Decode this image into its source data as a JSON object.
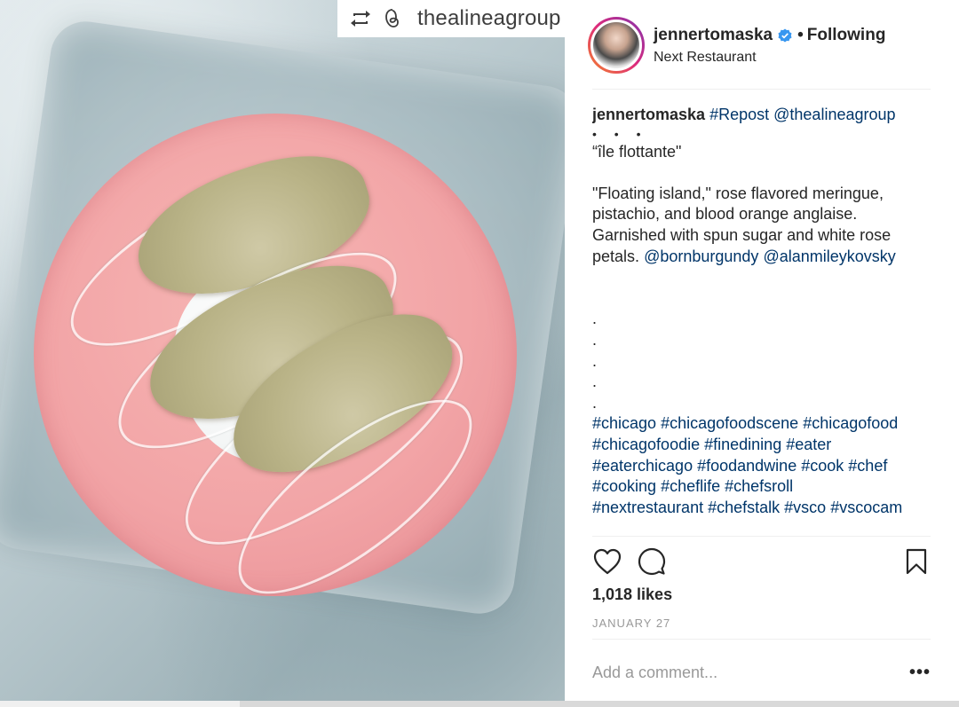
{
  "repost_tag": {
    "icons": [
      "repost-icon",
      "threads-icon"
    ],
    "username": "thealineagroup"
  },
  "header": {
    "username": "jennertomaska",
    "verified": true,
    "separator": "•",
    "follow_status": "Following",
    "location": "Next Restaurant"
  },
  "caption": {
    "author": "jennertomaska",
    "repost_tag": "#Repost",
    "repost_mention": "@thealineagroup",
    "dots_row": "• • •",
    "title": "“île flottante\"",
    "body_lines": [
      "\"Floating island,\" rose flavored meringue,",
      "pistachio, and blood orange anglaise.",
      "Garnished with spun sugar and white rose"
    ],
    "last_line_prefix": "petals.",
    "mention_1": "@bornburgundy",
    "mention_2": "@alanmileykovsky",
    "dots": [
      ".",
      ".",
      ".",
      ".",
      "."
    ],
    "hashtag_lines": [
      [
        "#chicago",
        "#chicagofoodscene",
        "#chicagofood"
      ],
      [
        "#chicagofoodie",
        "#finedining",
        "#eater"
      ],
      [
        "#eaterchicago",
        "#foodandwine",
        "#cook",
        "#chef"
      ],
      [
        "#cooking",
        "#cheflife",
        "#chefsroll"
      ],
      [
        "#nextrestaurant",
        "#chefstalk",
        "#vsco",
        "#vscocam"
      ]
    ]
  },
  "actions": {
    "icons": [
      "heart-icon",
      "comment-icon",
      "bookmark-icon"
    ]
  },
  "likes": "1,018 likes",
  "date": "JANUARY 27",
  "comment": {
    "placeholder": "Add a comment...",
    "more_label": "•••"
  },
  "colors": {
    "link": "#003569",
    "text": "#262626",
    "muted": "#999999",
    "verified": "#3897f0"
  }
}
